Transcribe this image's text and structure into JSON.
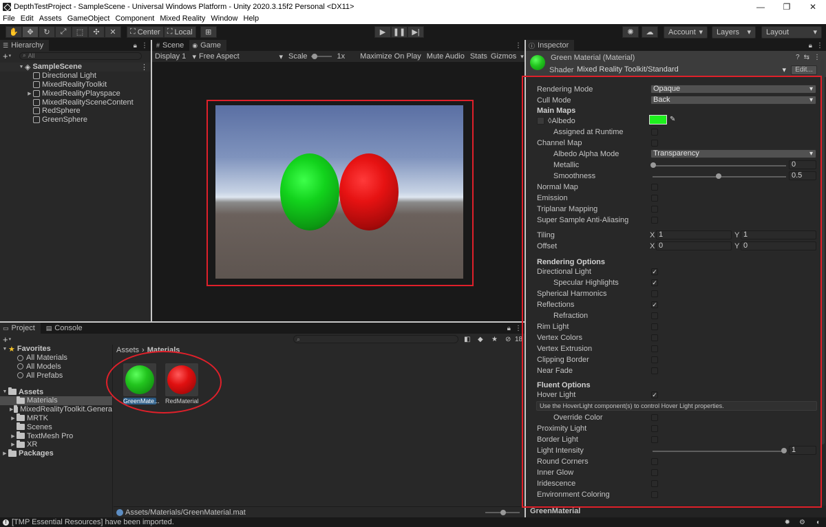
{
  "window": {
    "title": "DepthTestProject - SampleScene - Universal Windows Platform - Unity 2020.3.15f2 Personal <DX11>",
    "minimize": "—",
    "restore": "❐",
    "close": "✕"
  },
  "menu": [
    "File",
    "Edit",
    "Assets",
    "GameObject",
    "Component",
    "Mixed Reality",
    "Window",
    "Help"
  ],
  "toolbar": {
    "pivot_center": "Center",
    "pivot_local": "Local",
    "account": "Account",
    "layers": "Layers",
    "layout": "Layout"
  },
  "hierarchy": {
    "tab": "Hierarchy",
    "search_placeholder": "All",
    "scene": "SampleScene",
    "items": [
      "Directional Light",
      "MixedRealityToolkit",
      "MixedRealityPlayspace",
      "MixedRealitySceneContent",
      "RedSphere",
      "GreenSphere"
    ]
  },
  "game": {
    "tab_scene": "Scene",
    "tab_game": "Game",
    "display": "Display 1",
    "aspect": "Free Aspect",
    "scale_label": "Scale",
    "scale_value": "1x",
    "maximize": "Maximize On Play",
    "mute": "Mute Audio",
    "stats": "Stats",
    "gizmos": "Gizmos"
  },
  "project": {
    "tab_project": "Project",
    "tab_console": "Console",
    "hidden_count": "18",
    "favorites": "Favorites",
    "favorite_items": [
      "All Materials",
      "All Models",
      "All Prefabs"
    ],
    "assets": "Assets",
    "asset_folders": [
      "Materials",
      "MixedRealityToolkit.Genera",
      "MRTK",
      "Scenes",
      "TextMesh Pro",
      "XR"
    ],
    "packages": "Packages",
    "breadcrumb_root": "Assets",
    "breadcrumb_current": "Materials",
    "materials": [
      {
        "label": "GreenMate...",
        "color": "#22c41e"
      },
      {
        "label": "RedMaterial",
        "color": "#e01010"
      }
    ],
    "selected_path": "Assets/Materials/GreenMaterial.mat"
  },
  "inspector": {
    "tab": "Inspector",
    "material_name": "Green Material (Material)",
    "shader_label": "Shader",
    "shader_value": "Mixed Reality Toolkit/Standard",
    "edit_button": "Edit...",
    "rendering_mode_label": "Rendering Mode",
    "rendering_mode_value": "Opaque",
    "cull_mode_label": "Cull Mode",
    "cull_mode_value": "Back",
    "main_maps": "Main Maps",
    "albedo": "Albedo",
    "albedo_color": "#1ef01e",
    "assigned_runtime": "Assigned at Runtime",
    "channel_map": "Channel Map",
    "albedo_alpha_label": "Albedo Alpha Mode",
    "albedo_alpha_value": "Transparency",
    "metallic_label": "Metallic",
    "metallic_value": "0",
    "smoothness_label": "Smoothness",
    "smoothness_value": "0.5",
    "normal_map": "Normal Map",
    "emission": "Emission",
    "triplanar": "Triplanar Mapping",
    "super_sample": "Super Sample Anti-Aliasing",
    "tiling_label": "Tiling",
    "offset_label": "Offset",
    "x_label": "X",
    "y_label": "Y",
    "tiling_x": "1",
    "tiling_y": "1",
    "offset_x": "0",
    "offset_y": "0",
    "rendering_options": "Rendering Options",
    "directional_light": "Directional Light",
    "specular": "Specular Highlights",
    "spherical": "Spherical Harmonics",
    "reflections": "Reflections",
    "refraction": "Refraction",
    "rim_light": "Rim Light",
    "vertex_colors": "Vertex Colors",
    "vertex_extrusion": "Vertex Extrusion",
    "clipping_border": "Clipping Border",
    "near_fade": "Near Fade",
    "fluent_options": "Fluent Options",
    "hover_light": "Hover Light",
    "hover_help": "Use the HoverLight component(s) to control Hover Light properties.",
    "override_color": "Override Color",
    "proximity_light": "Proximity Light",
    "border_light": "Border Light",
    "light_intensity_label": "Light Intensity",
    "light_intensity_value": "1",
    "round_corners": "Round Corners",
    "inner_glow": "Inner Glow",
    "iridescence": "Iridescence",
    "environment_coloring": "Environment Coloring",
    "footer_name": "GreenMaterial"
  },
  "status": {
    "message": "[TMP Essential Resources] have been imported."
  }
}
